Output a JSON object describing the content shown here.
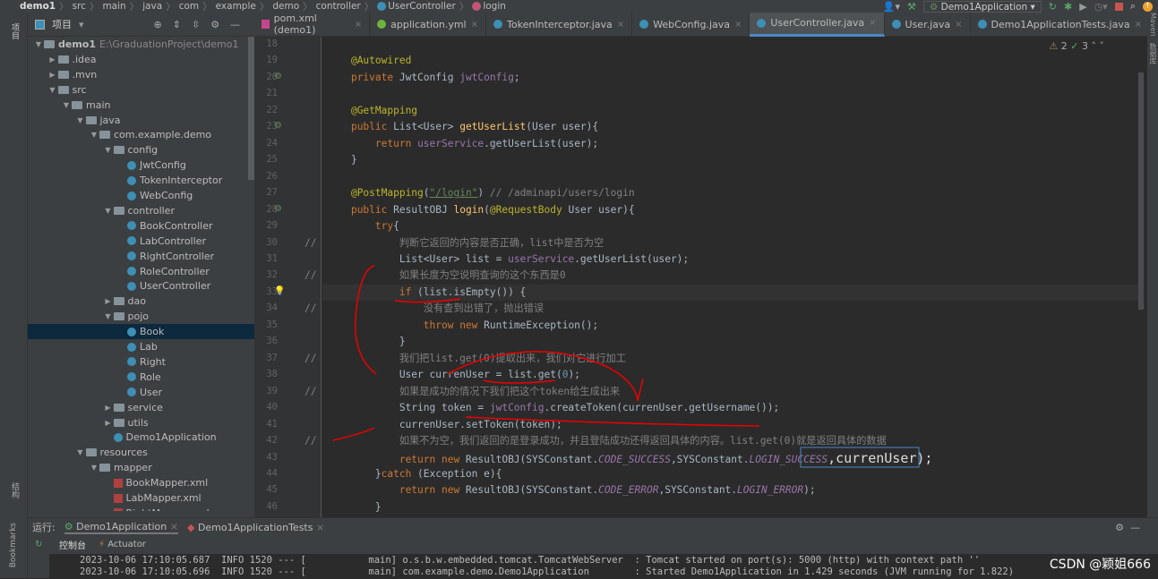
{
  "breadcrumb": [
    "demo1",
    "src",
    "main",
    "java",
    "com",
    "example",
    "demo",
    "controller",
    "UserController",
    "login"
  ],
  "toolbar": {
    "run_config": "Demo1Application"
  },
  "left_strip": {
    "project": "项目",
    "structure": "结构",
    "bookmarks": "Bookmarks"
  },
  "project": {
    "title": "项目",
    "tree": [
      {
        "d": 0,
        "t": "folder",
        "open": true,
        "label": "demo1",
        "path": "E:\\GraduationProject\\demo1",
        "bold": true
      },
      {
        "d": 1,
        "t": "folder",
        "open": false,
        "label": ".idea"
      },
      {
        "d": 1,
        "t": "folder",
        "open": false,
        "label": ".mvn"
      },
      {
        "d": 1,
        "t": "folder",
        "open": true,
        "label": "src"
      },
      {
        "d": 2,
        "t": "folder",
        "open": true,
        "label": "main"
      },
      {
        "d": 3,
        "t": "folder",
        "open": true,
        "label": "java"
      },
      {
        "d": 4,
        "t": "folder",
        "open": true,
        "label": "com.example.demo"
      },
      {
        "d": 5,
        "t": "folder",
        "open": true,
        "label": "config"
      },
      {
        "d": 6,
        "t": "class",
        "label": "JwtConfig"
      },
      {
        "d": 6,
        "t": "class",
        "label": "TokenInterceptor"
      },
      {
        "d": 6,
        "t": "class",
        "label": "WebConfig"
      },
      {
        "d": 5,
        "t": "folder",
        "open": true,
        "label": "controller"
      },
      {
        "d": 6,
        "t": "class",
        "label": "BookController"
      },
      {
        "d": 6,
        "t": "class",
        "label": "LabController"
      },
      {
        "d": 6,
        "t": "class",
        "label": "RightController"
      },
      {
        "d": 6,
        "t": "class",
        "label": "RoleController"
      },
      {
        "d": 6,
        "t": "class",
        "label": "UserController"
      },
      {
        "d": 5,
        "t": "folder",
        "open": false,
        "label": "dao"
      },
      {
        "d": 5,
        "t": "folder",
        "open": true,
        "label": "pojo"
      },
      {
        "d": 6,
        "t": "class",
        "label": "Book",
        "selected": true
      },
      {
        "d": 6,
        "t": "class",
        "label": "Lab"
      },
      {
        "d": 6,
        "t": "class",
        "label": "Right"
      },
      {
        "d": 6,
        "t": "class",
        "label": "Role"
      },
      {
        "d": 6,
        "t": "class",
        "label": "User"
      },
      {
        "d": 5,
        "t": "folder",
        "open": false,
        "label": "service"
      },
      {
        "d": 5,
        "t": "folder",
        "open": false,
        "label": "utils"
      },
      {
        "d": 5,
        "t": "class",
        "label": "Demo1Application"
      },
      {
        "d": 3,
        "t": "folder",
        "open": true,
        "label": "resources"
      },
      {
        "d": 4,
        "t": "folder",
        "open": true,
        "label": "mapper"
      },
      {
        "d": 5,
        "t": "xml",
        "label": "BookMapper.xml"
      },
      {
        "d": 5,
        "t": "xml",
        "label": "LabMapper.xml"
      },
      {
        "d": 5,
        "t": "xml",
        "label": "RightMapper.xml"
      }
    ]
  },
  "tabs": [
    {
      "label": "pom.xml (demo1)",
      "icon": "maven"
    },
    {
      "label": "application.yml",
      "icon": "spring"
    },
    {
      "label": "TokenInterceptor.java",
      "icon": "class"
    },
    {
      "label": "WebConfig.java",
      "icon": "class"
    },
    {
      "label": "UserController.java",
      "icon": "class",
      "active": true
    },
    {
      "label": "User.java",
      "icon": "class"
    },
    {
      "label": "Demo1ApplicationTests.java",
      "icon": "test"
    }
  ],
  "inspections": {
    "warnings": "2",
    "weak": "3"
  },
  "code": [
    {
      "n": 18,
      "c": ""
    },
    {
      "n": 19,
      "c": "    <a>@Autowired</a>"
    },
    {
      "n": 20,
      "c": "    <k>private</k> JwtConfig <f>jwtConfig</f>;",
      "g": "bean"
    },
    {
      "n": 21,
      "c": ""
    },
    {
      "n": 22,
      "c": "    <a>@GetMapping</a>"
    },
    {
      "n": 23,
      "c": "    <k>public</k> List&lt;User&gt; <m>getUserList</m>(User user){",
      "g": "bean"
    },
    {
      "n": 24,
      "c": "        <k>return</k> <f>userService</f>.getUserList(user);"
    },
    {
      "n": 25,
      "c": "    }"
    },
    {
      "n": 26,
      "c": ""
    },
    {
      "n": 27,
      "c": "    <a>@PostMapping</a>(<s>\"/login\"</s>) <cm>// /adminapi/users/login</cm>"
    },
    {
      "n": 28,
      "c": "    <k>public</k> ResultOBJ <m>login</m>(<a>@RequestBody</a> User user){",
      "g": "bean"
    },
    {
      "n": 29,
      "c": "        <k>try</k>{"
    },
    {
      "n": 30,
      "c": "            <cm>判断它返回的内容是否正确，list中是否为空</cm>",
      "cm": true
    },
    {
      "n": 31,
      "c": "            List&lt;User&gt; list = <f>userService</f>.getUserList(user);"
    },
    {
      "n": 32,
      "c": "            <cm>如果长度为空说明查询的这个东西是0</cm>",
      "cm": true
    },
    {
      "n": 33,
      "c": "            <k>if</k> (list.isEmpty()) {",
      "hl": true,
      "g": "bulb"
    },
    {
      "n": 34,
      "c": "                <cm>没有查到出错了，抛出错误</cm>",
      "cm": true
    },
    {
      "n": 35,
      "c": "                <k>throw new</k> RuntimeException();"
    },
    {
      "n": 36,
      "c": "            }"
    },
    {
      "n": 37,
      "c": "            <cm>我们把list.get(0)提取出来，我们对它进行加工</cm>",
      "cm": true
    },
    {
      "n": 38,
      "c": "            User currenUser = list.get(<num>0</num>);"
    },
    {
      "n": 39,
      "c": "            <cm>如果是成功的情况下我们把这个token给生成出来</cm>",
      "cm": true
    },
    {
      "n": 40,
      "c": "            String token = <f>jwtConfig</f>.createToken(currenUser.getUsername());"
    },
    {
      "n": 41,
      "c": "            currenUser.setToken(token);"
    },
    {
      "n": 42,
      "c": "            <cm>如果不为空，我们返回的是登录成功，并且登陆成功还得返回具体的内容。list.get(0)就是返回具体的数据</cm>",
      "cm": true
    },
    {
      "n": 43,
      "c": "            <k>return new</k> ResultOBJ(SYSConstant.<i>CODE_SUCCESS</i>,SYSConstant.<i>LOGIN_SUCCESS</i><big>,currenUser);</big>"
    },
    {
      "n": 44,
      "c": "        }<k>catch</k> (Exception e){"
    },
    {
      "n": 45,
      "c": "            <k>return new</k> ResultOBJ(SYSConstant.<i>CODE_ERROR</i>,SYSConstant.<i>LOGIN_ERROR</i>);"
    },
    {
      "n": 46,
      "c": "        }"
    }
  ],
  "bottom": {
    "run_label": "运行:",
    "run_tabs": [
      "Demo1Application",
      "Demo1ApplicationTests"
    ],
    "console_tab": "控制台",
    "actuator_tab": "Actuator",
    "log": [
      "2023-10-06 17:10:05.687  INFO 1520 --- [           main] o.s.b.w.embedded.tomcat.TomcatWebServer  : Tomcat started on port(s): 5000 (http) with context path ''",
      "2023-10-06 17:10:05.696  INFO 1520 --- [           main] com.example.demo.Demo1Application        : Started Demo1Application in 1.429 seconds (JVM running for 1.822)"
    ]
  },
  "watermark": "CSDN @颖姐666"
}
